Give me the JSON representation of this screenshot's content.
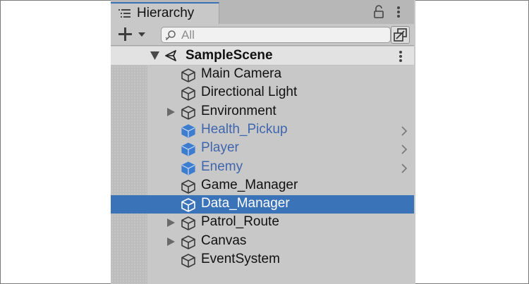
{
  "tab": {
    "title": "Hierarchy",
    "icon": "list-icon"
  },
  "toolbar": {
    "add_icon": "plus-icon",
    "search": {
      "placeholder": "All",
      "value": ""
    }
  },
  "scene": {
    "name": "SampleScene",
    "icon": "unity-scene-icon",
    "expanded": true
  },
  "rows": [
    {
      "label": "Main Camera",
      "icon": "gameobject-icon",
      "expander": false,
      "prefab": false,
      "selected": false
    },
    {
      "label": "Directional Light",
      "icon": "gameobject-icon",
      "expander": false,
      "prefab": false,
      "selected": false
    },
    {
      "label": "Environment",
      "icon": "gameobject-icon",
      "expander": true,
      "prefab": false,
      "selected": false
    },
    {
      "label": "Health_Pickup",
      "icon": "prefab-icon",
      "expander": false,
      "prefab": true,
      "selected": false
    },
    {
      "label": "Player",
      "icon": "prefab-icon",
      "expander": false,
      "prefab": true,
      "selected": false
    },
    {
      "label": "Enemy",
      "icon": "prefab-icon",
      "expander": false,
      "prefab": true,
      "selected": false
    },
    {
      "label": "Game_Manager",
      "icon": "gameobject-icon",
      "expander": false,
      "prefab": false,
      "selected": false
    },
    {
      "label": "Data_Manager",
      "icon": "gameobject-icon",
      "expander": false,
      "prefab": false,
      "selected": true
    },
    {
      "label": "Patrol_Route",
      "icon": "gameobject-icon",
      "expander": true,
      "prefab": false,
      "selected": false
    },
    {
      "label": "Canvas",
      "icon": "gameobject-icon",
      "expander": true,
      "prefab": false,
      "selected": false
    },
    {
      "label": "EventSystem",
      "icon": "gameobject-icon",
      "expander": false,
      "prefab": false,
      "selected": false
    }
  ],
  "colors": {
    "panel_bg": "#c8c8c8",
    "selection": "#3b73b9",
    "prefab_text": "#3f66ad",
    "prefab_icon": "#3d7dd0",
    "active_tab_accent": "#3a72b8"
  }
}
